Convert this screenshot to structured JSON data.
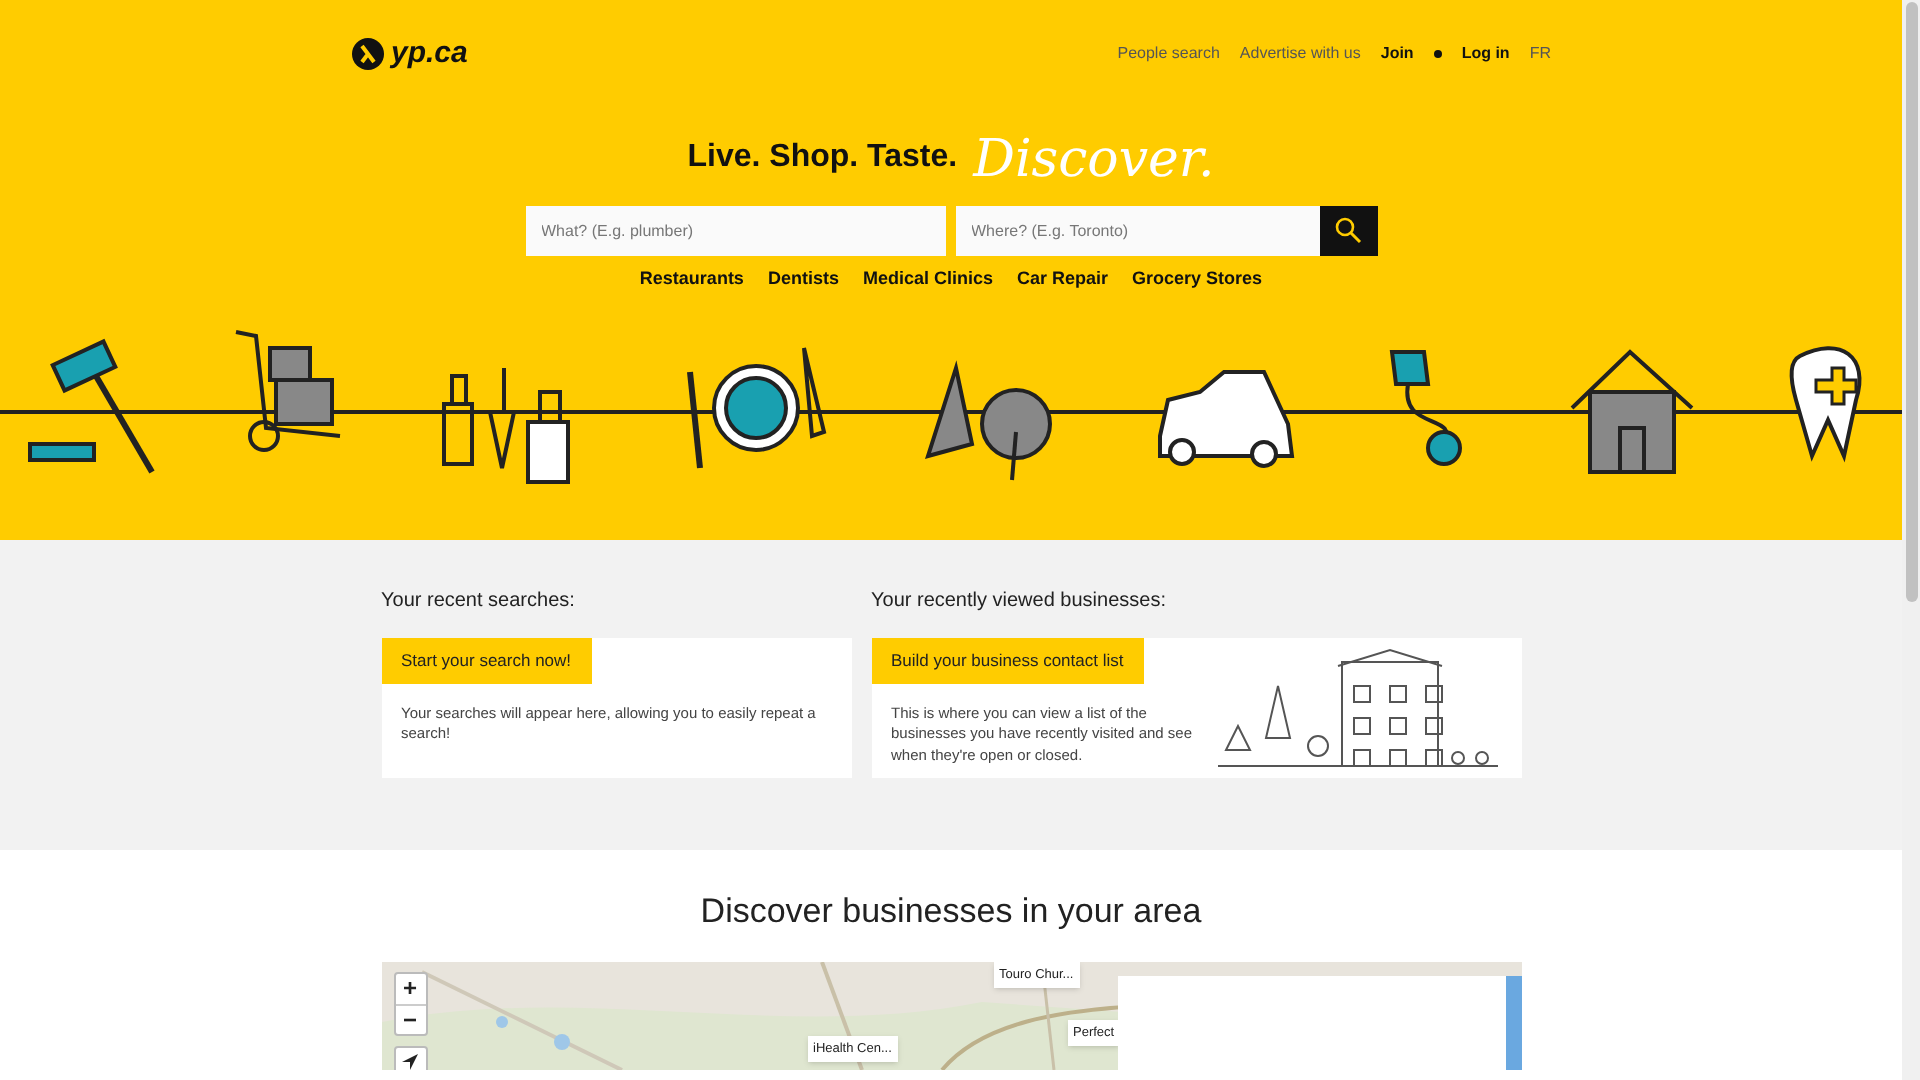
{
  "header": {
    "logo": "yp.ca",
    "nav": [
      {
        "label": "People search",
        "kind": "plain"
      },
      {
        "label": "Advertise with us",
        "kind": "plain"
      },
      {
        "label": "Join",
        "kind": "bold"
      },
      {
        "label": "Log in",
        "kind": "bold"
      },
      {
        "label": "FR",
        "kind": "plain"
      }
    ]
  },
  "hero": {
    "tagline": "Live. Shop. Taste.",
    "script_word": "Discover.",
    "what_placeholder": "What? (E.g. plumber)",
    "where_placeholder": "Where? (E.g. Toronto)",
    "categories": [
      "Restaurants",
      "Dentists",
      "Medical Clinics",
      "Car Repair",
      "Grocery Stores"
    ]
  },
  "recent": [
    {
      "heading": "Your recent searches:",
      "tag": "Start your search now!",
      "text": "Your searches will appear here, allowing you to easily repeat a search!",
      "kind": "plain"
    },
    {
      "heading": "Your recently viewed businesses:",
      "tag": "Build your business contact list",
      "text": "This is where you can view a list of the businesses you have recently visited and see when they're open or closed.",
      "kind": "illustrated"
    }
  ],
  "discover": {
    "title": "Discover businesses in your area",
    "zoom_in": "+",
    "zoom_out": "−",
    "pins": [
      "Touro Chur...",
      "iHealth Cen...",
      "Perfect"
    ]
  }
}
